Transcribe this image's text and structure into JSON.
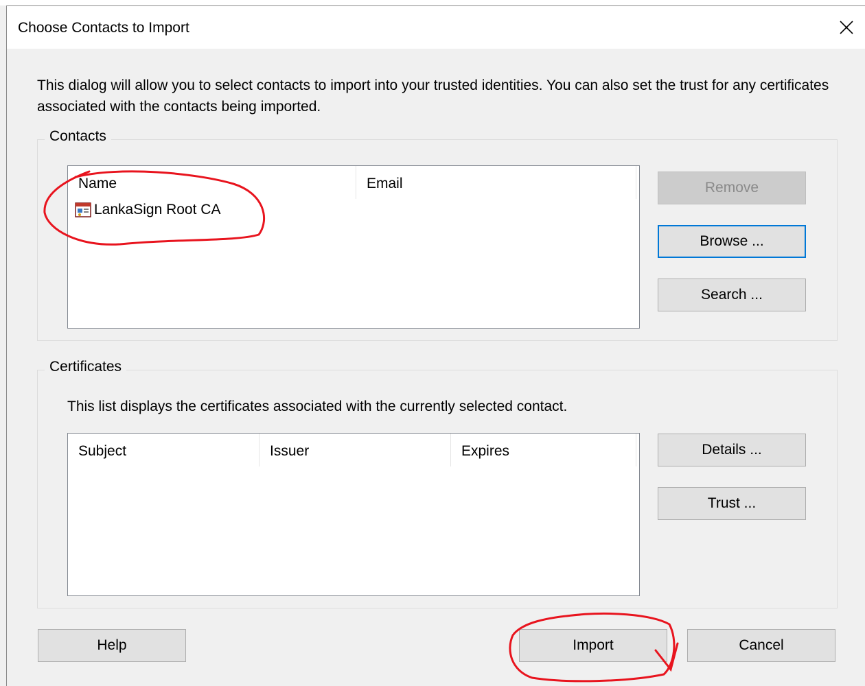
{
  "dialog": {
    "title": "Choose Contacts to Import",
    "intro": "This dialog will allow you to select contacts to import into your trusted identities. You can also set the trust for any certificates associated with the contacts being imported."
  },
  "contacts": {
    "legend": "Contacts",
    "columns": [
      "Name",
      "Email"
    ],
    "rows": [
      {
        "name": "LankaSign Root CA",
        "email": "",
        "icon": "certificate-contact-icon"
      }
    ],
    "buttons": {
      "remove": "Remove",
      "browse": "Browse ...",
      "search": "Search ..."
    }
  },
  "certificates": {
    "legend": "Certificates",
    "description": "This list displays the certificates associated with the currently selected contact.",
    "columns": [
      "Subject",
      "Issuer",
      "Expires"
    ],
    "rows": [],
    "buttons": {
      "details": "Details ...",
      "trust": "Trust ..."
    }
  },
  "footer": {
    "help": "Help",
    "import": "Import",
    "cancel": "Cancel"
  },
  "colors": {
    "focus_border": "#0078d7",
    "annotation": "#e8141e"
  }
}
